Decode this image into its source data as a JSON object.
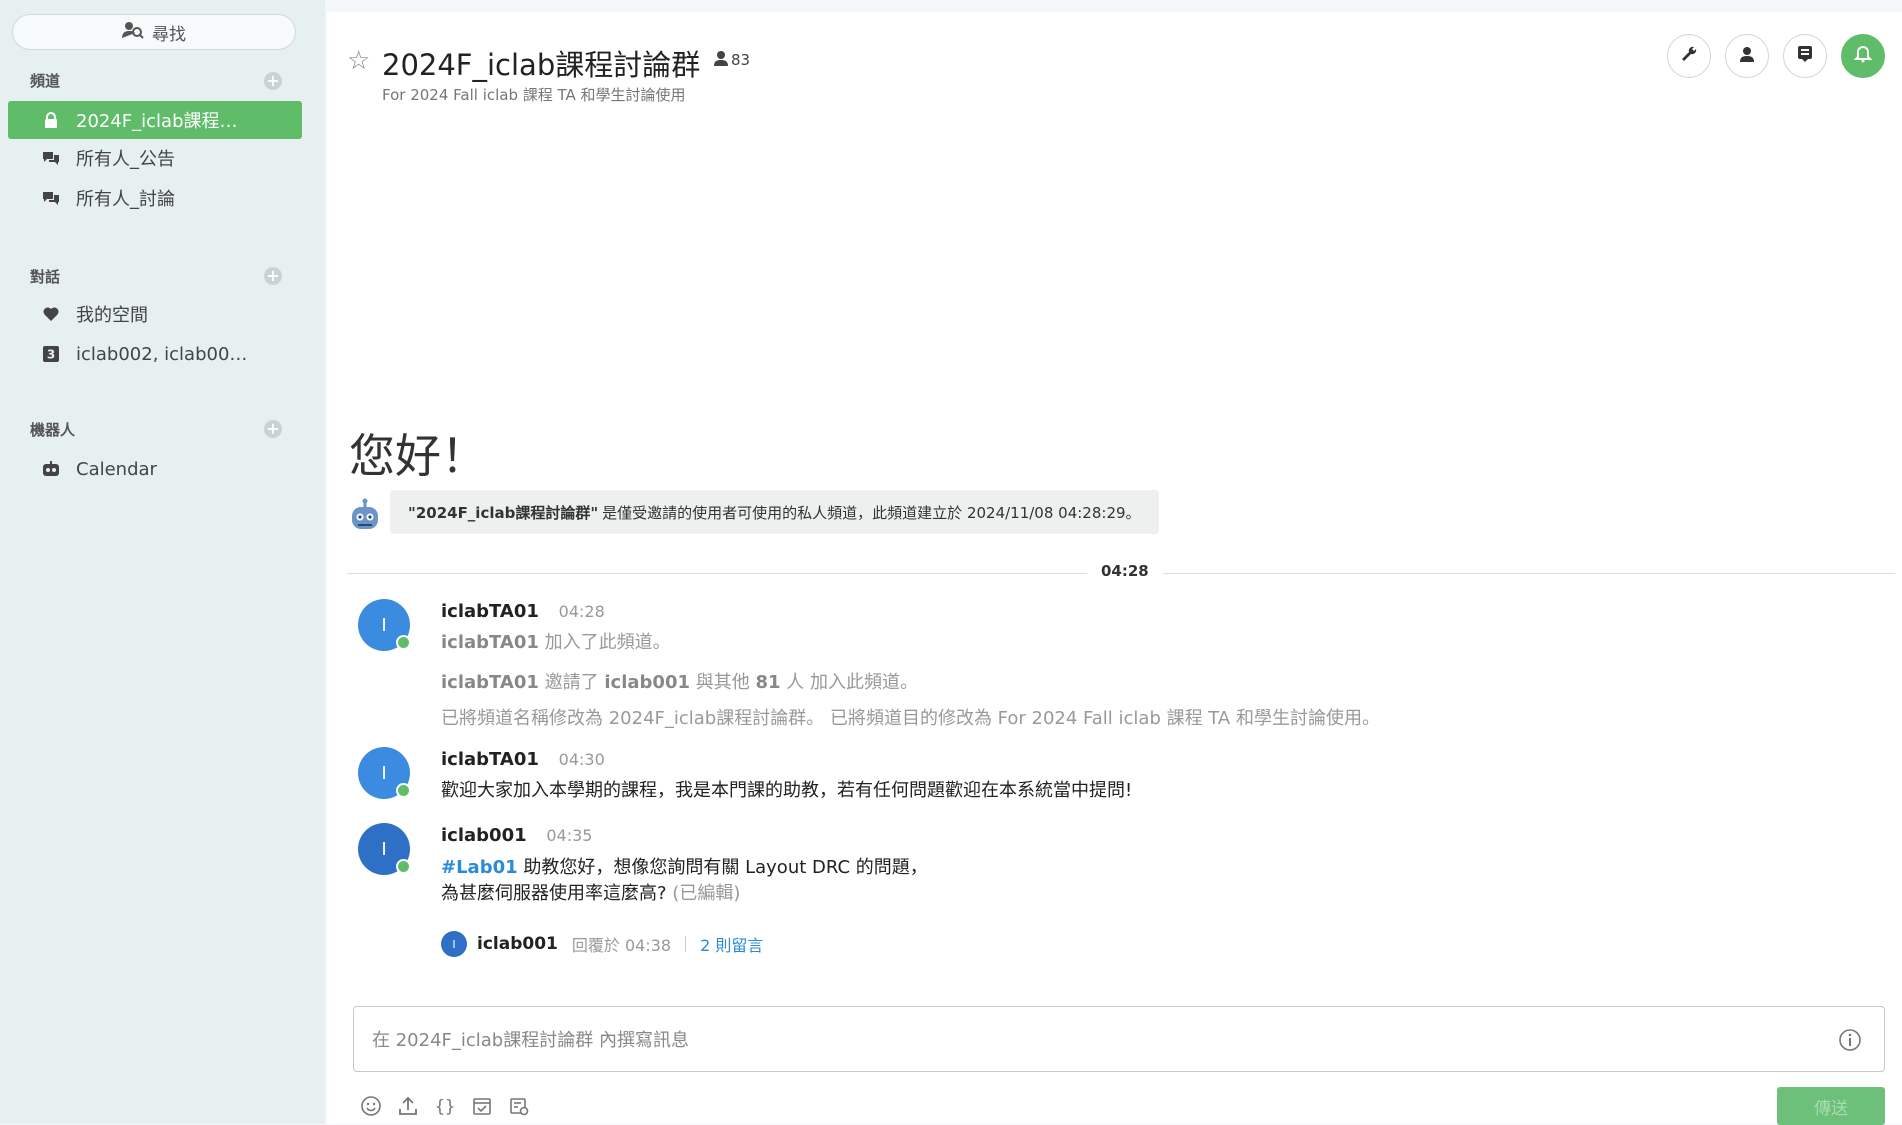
{
  "search": {
    "label": "尋找"
  },
  "sidebar": {
    "channels": {
      "title": "頻道",
      "items": [
        {
          "label": "2024F_iclab課程…",
          "icon": "lock-icon",
          "active": true
        },
        {
          "label": "所有人_公告",
          "icon": "chat-icon"
        },
        {
          "label": "所有人_討論",
          "icon": "chat-icon"
        }
      ]
    },
    "conversations": {
      "title": "對話",
      "items": [
        {
          "label": "我的空間",
          "icon": "heart-icon"
        },
        {
          "label": "iclab002, iclab00…",
          "icon": "group-count-icon",
          "badge": "3"
        }
      ]
    },
    "bots": {
      "title": "機器人",
      "items": [
        {
          "label": "Calendar",
          "icon": "bot-icon"
        }
      ]
    }
  },
  "header": {
    "title": "2024F_iclab課程討論群",
    "member_count": "83",
    "description": "For 2024 Fall iclab 課程 TA 和學生討論使用",
    "accent": "#5fbd6a"
  },
  "intro": {
    "greeting": "您好！",
    "bot_channel": "\"2024F_iclab課程討論群\"",
    "bot_text": "是僅受邀請的使用者可使用的私人頻道，此頻道建立於 2024/11/08 04:28:29。"
  },
  "divider_time": "04:28",
  "messages": [
    {
      "avatar": "I",
      "user": "iclabTA01",
      "time": "04:28",
      "lines": [
        {
          "user": "iclabTA01",
          "text": "加入了此頻道。"
        },
        {
          "user": "iclabTA01",
          "text1": "邀請了",
          "user2": "iclab001",
          "text2": "與其他",
          "count": "81",
          "text3": "人 加入此頻道。"
        },
        {
          "text": "已將頻道名稱修改為 2024F_iclab課程討論群。 已將頻道目的修改為 For 2024 Fall iclab 課程 TA 和學生討論使用。"
        }
      ]
    },
    {
      "avatar": "I",
      "user": "iclabTA01",
      "time": "04:30",
      "text": "歡迎大家加入本學期的課程，我是本門課的助教，若有任何問題歡迎在本系統當中提問!"
    },
    {
      "avatar": "I",
      "user": "iclab001",
      "time": "04:35",
      "tag": "#Lab01",
      "text1": "助教您好，想像您詢問有關 Layout DRC 的問題，",
      "text2": "為甚麼伺服器使用率這麼高?",
      "edited": "(已編輯)",
      "reply": {
        "avatar": "I",
        "user": "iclab001",
        "meta": "回覆於 04:38",
        "count": "2 則留言"
      }
    }
  ],
  "composer": {
    "placeholder": "在 2024F_iclab課程討論群 內撰寫訊息",
    "send_label": "傳送",
    "tools": [
      "emoji-icon",
      "upload-icon",
      "code-icon",
      "calendar-icon",
      "vote-icon"
    ]
  }
}
